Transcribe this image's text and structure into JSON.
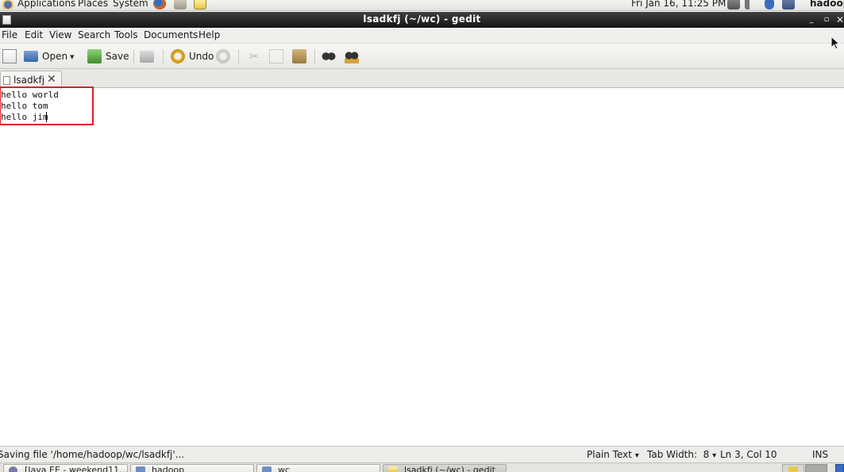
{
  "top_panel": {
    "menus": [
      "Applications",
      "Places",
      "System"
    ],
    "clock": "Fri Jan 16, 11:25 PM",
    "user": "hadoop",
    "launcher_icons": [
      "firefox-icon",
      "mail-icon",
      "notes-icon"
    ],
    "tray_icons": [
      "network-icon",
      "volume-icon",
      "bluetooth-icon",
      "display-icon"
    ]
  },
  "window": {
    "title": "lsadkfj (~/wc) - gedit",
    "controls": [
      "minimize-icon",
      "maximize-icon",
      "close-icon"
    ]
  },
  "menubar": {
    "items": [
      "File",
      "Edit",
      "View",
      "Search",
      "Tools",
      "Documents",
      "Help"
    ]
  },
  "toolbar": {
    "open_label": "Open",
    "save_label": "Save",
    "undo_label": "Undo",
    "icons": [
      "new-document-icon",
      "open-icon",
      "open-dropdown-icon",
      "save-icon",
      "print-icon",
      "undo-icon",
      "redo-icon",
      "cut-icon",
      "copy-icon",
      "paste-icon",
      "find-icon",
      "find-replace-icon"
    ]
  },
  "tab": {
    "label": "lsadkfj"
  },
  "editor": {
    "lines": [
      "hello world",
      "hello tom",
      "hello jim"
    ],
    "highlight_color": "#e01b24"
  },
  "statusbar": {
    "message": "Saving file '/home/hadoop/wc/lsadkfj'...",
    "language": "Plain Text",
    "tab_width": "Tab Width:  8",
    "position": "Ln 3, Col 10",
    "mode": "INS"
  },
  "taskbar": {
    "tasks": [
      {
        "label": "[Java EE - weekend11..."
      },
      {
        "label": "hadoop"
      },
      {
        "label": "wc"
      },
      {
        "label": "lsadkfj (~/wc) - gedit"
      }
    ]
  }
}
